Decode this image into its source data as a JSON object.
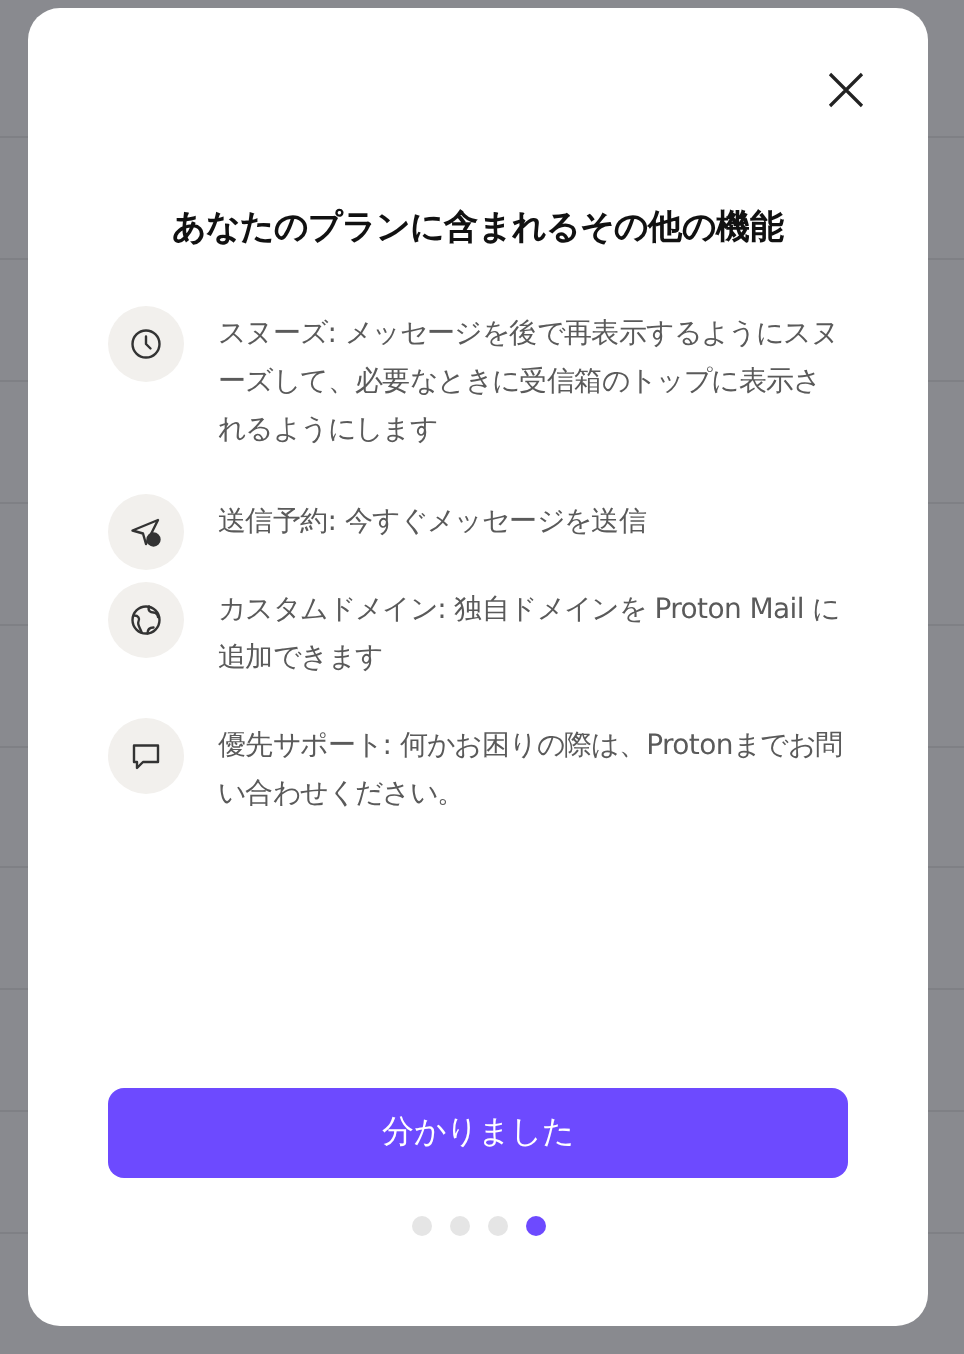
{
  "dialog": {
    "title": "あなたのプランに含まれるその他の機能",
    "features": [
      {
        "kind": "clock",
        "text": "スヌーズ: メッセージを後で再表示するようにスヌーズして、必要なときに受信箱のトップに表示されるようにします"
      },
      {
        "kind": "schedule",
        "text": "送信予約: 今すぐメッセージを送信"
      },
      {
        "kind": "globe",
        "text": "カスタムドメイン: 独自ドメインを Proton Mail に追加できます"
      },
      {
        "kind": "chat",
        "text": "優先サポート: 何かお困りの際は、Protonまでお問い合わせください。"
      }
    ],
    "button": "分かりました",
    "steps": [
      {
        "selected": false
      },
      {
        "selected": false
      },
      {
        "selected": false
      },
      {
        "selected": true
      }
    ]
  }
}
